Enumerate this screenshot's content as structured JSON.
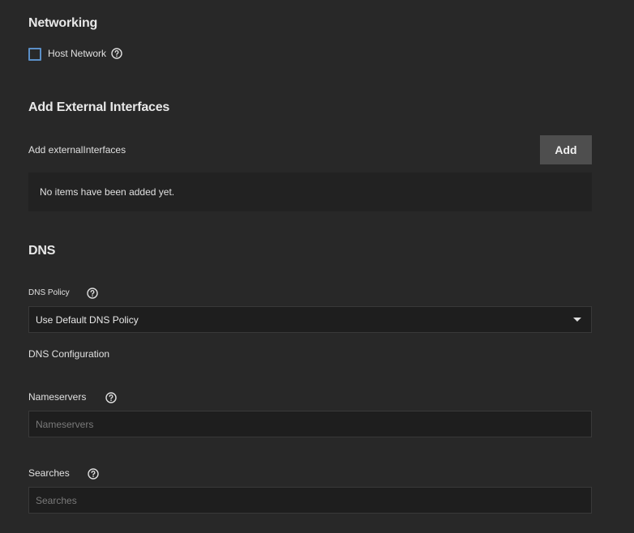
{
  "networking": {
    "title": "Networking",
    "host_network_label": "Host Network",
    "host_network_checked": false
  },
  "external_interfaces": {
    "title": "Add External Interfaces",
    "list_label": "Add externalInterfaces",
    "add_button_label": "Add",
    "empty_message": "No items have been added yet."
  },
  "dns": {
    "title": "DNS",
    "policy_label": "DNS Policy",
    "policy_value": "Use Default DNS Policy",
    "config_label": "DNS Configuration",
    "nameservers_label": "Nameservers",
    "nameservers_placeholder": "Nameservers",
    "nameservers_value": "",
    "searches_label": "Searches",
    "searches_placeholder": "Searches",
    "searches_value": ""
  },
  "icons": {
    "help": "question-circle-icon",
    "dropdown": "caret-down-icon"
  },
  "colors": {
    "background": "#282828",
    "checkbox_border": "#5b8fc7",
    "button_bg": "#4e4e4e",
    "input_bg": "#1e1e1e"
  }
}
